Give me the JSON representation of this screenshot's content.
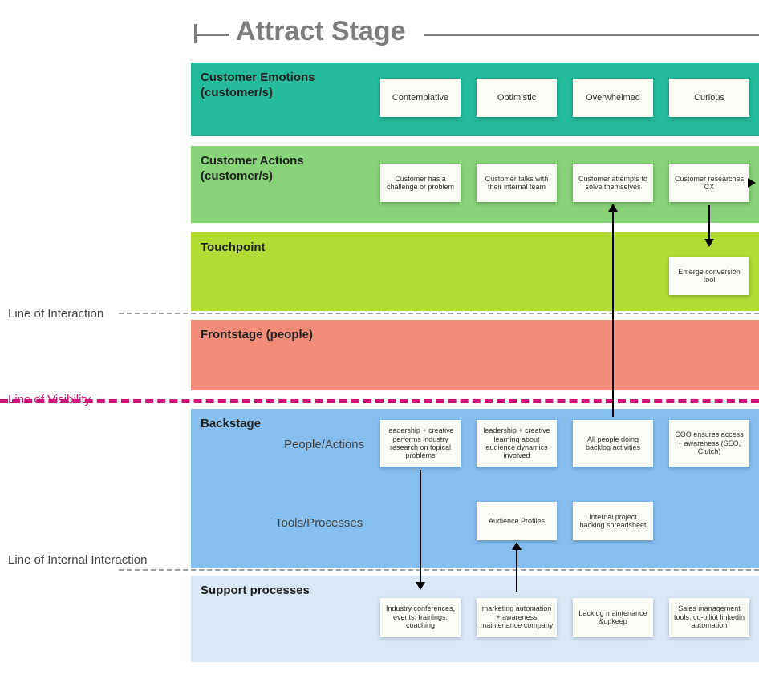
{
  "stage_title": "Attract Stage",
  "left_labels": {
    "interaction": "Line of Interaction",
    "visibility": "Line of Visibility",
    "internal": "Line of Internal Interaction"
  },
  "rows": {
    "emotions": {
      "label": "Customer Emotions (customer/s)"
    },
    "actions": {
      "label": "Customer Actions (customer/s)"
    },
    "touch": {
      "label": "Touchpoint"
    },
    "front": {
      "label": "Frontstage (people)"
    },
    "backstage": {
      "label": "Backstage",
      "sub_people": "People/Actions",
      "sub_tools": "Tools/Processes"
    },
    "support": {
      "label": "Support processes"
    }
  },
  "emotions": [
    "Contemplative",
    "Optimistic",
    "Overwhelmed",
    "Curious"
  ],
  "actions": [
    "Customer has a challenge or problem",
    "Customer talks with their internal team",
    "Customer attempts to solve themselves",
    "Customer researches CX"
  ],
  "touchpoints": [
    "Emerge conversion tool"
  ],
  "backstage_people": [
    "leadership + creative performs industry research on topical problems",
    "leadership + creative learning about audience dynamics involved",
    "All people doing backlog activities",
    "COO ensures access + awareness (SEO, Clutch)"
  ],
  "backstage_tools": [
    "Audience Profiles",
    "Internal project backlog spreadsheet"
  ],
  "support": [
    "Industry conferences, events, trainings, coaching",
    "marketing automation + awareness maintenance company",
    "backlog maintenance &upkeep",
    "Sales management tools, co-piliot linkedin automation"
  ]
}
